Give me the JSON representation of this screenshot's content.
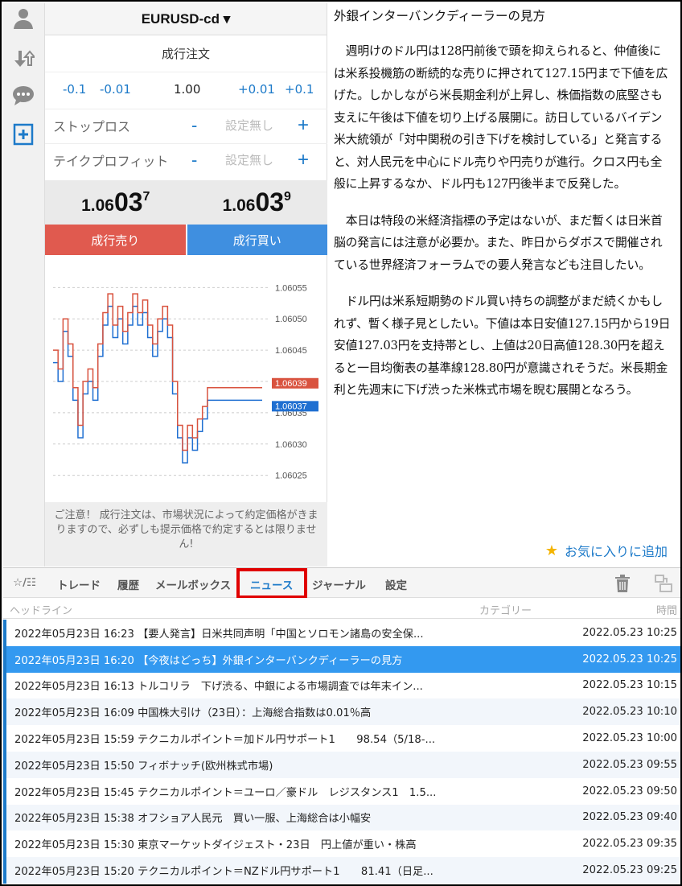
{
  "sidebar": {
    "icons": [
      "account-icon",
      "trade-transfer-icon",
      "chat-icon",
      "new-order-icon"
    ]
  },
  "order_panel": {
    "symbol": "EURUSD-cd ▾",
    "order_type": "成行注文",
    "volume_steps": {
      "m01": "-0.1",
      "m001": "-0.01",
      "p001": "+0.01",
      "p01": "+0.1"
    },
    "volume": "1.00",
    "stop_loss": {
      "label": "ストップロス",
      "minus": "-",
      "placeholder": "設定無し",
      "plus": "+"
    },
    "take_profit": {
      "label": "テイクプロフィット",
      "minus": "-",
      "placeholder": "設定無し",
      "plus": "+"
    },
    "bid": {
      "a": "1.06",
      "b": "03",
      "c": "7"
    },
    "ask": {
      "a": "1.06",
      "b": "03",
      "c": "9"
    },
    "sell_label": "成行売り",
    "buy_label": "成行買い",
    "notice": "ご注意！ 成行注文は、市場状況によって約定価格がきまりますので、必ずしも提示価格で約定するとは限りません!"
  },
  "chart_data": {
    "type": "line",
    "y_ticks": [
      "1.06055",
      "1.06050",
      "1.06045",
      "1.06040",
      "1.06035",
      "1.06030",
      "1.06025"
    ],
    "ylim": [
      1.06022,
      1.06058
    ],
    "bid_label": "1.06037",
    "ask_label": "1.06039",
    "series": [
      {
        "color": "#1f6fd1",
        "values": [
          1.06043,
          1.0604,
          1.06048,
          1.06044,
          1.06037,
          1.06031,
          1.06038,
          1.0604,
          1.06037,
          1.06044,
          1.06049,
          1.06052,
          1.06047,
          1.0605,
          1.06046,
          1.06049,
          1.06052,
          1.06049,
          1.06051,
          1.06047,
          1.06044,
          1.06048,
          1.0605,
          1.06047,
          1.06038,
          1.06031,
          1.06027,
          1.06031,
          1.06029,
          1.06032,
          1.06034,
          1.06037,
          1.06037,
          1.06037,
          1.06037,
          1.06037,
          1.06037,
          1.06037,
          1.06037,
          1.06037,
          1.06037,
          1.06037,
          1.06037
        ]
      },
      {
        "color": "#d9533f",
        "values": [
          1.06045,
          1.06042,
          1.0605,
          1.06046,
          1.06039,
          1.06033,
          1.0604,
          1.06042,
          1.06039,
          1.06046,
          1.06051,
          1.06054,
          1.06049,
          1.06052,
          1.06048,
          1.06051,
          1.06054,
          1.06051,
          1.06053,
          1.06049,
          1.06046,
          1.0605,
          1.06052,
          1.06049,
          1.0604,
          1.06033,
          1.06029,
          1.06033,
          1.06031,
          1.06034,
          1.06036,
          1.06039,
          1.06039,
          1.06039,
          1.06039,
          1.06039,
          1.06039,
          1.06039,
          1.06039,
          1.06039,
          1.06039,
          1.06039,
          1.06039
        ]
      }
    ]
  },
  "article": {
    "title": "外銀インターバンクディーラーの見方",
    "paragraphs": [
      "週明けのドル円は128円前後で頭を抑えられると、仲値後には米系投機筋の断続的な売りに押されて127.15円まで下値を広げた。しかしながら米長期金利が上昇し、株価指数の底堅さも支えに午後は下値を切り上げる展開に。訪日しているバイデン米大統領が「対中関税の引き下げを検討している」と発言すると、対人民元を中心にドル売りや円売りが進行。クロス円も全般に上昇するなか、ドル円も127円後半まで反発した。",
      "本日は特段の米経済指標の予定はないが、まだ暫くは日米首脳の発言には注意が必要か。また、昨日からダボスで開催されている世界経済フォーラムでの要人発言なども注目したい。",
      "ドル円は米系短期勢のドル買い持ちの調整がまだ続くかもしれず、暫く様子見としたい。下値は本日安値127.15円から19日安値127.03円を支持帯とし、上値は20日高値128.30円を超えると一目均衡表の基準線128.80円が意識されそうだ。米長期金利と先週末に下げ渋った米株式市場を睨む展開となろう。"
    ],
    "favorite_label": "お気に入りに追加"
  },
  "tabs": {
    "toggle": "☆/☷",
    "trade": "トレード",
    "history": "履歴",
    "mailbox": "メールボックス",
    "news": "ニュース",
    "journal": "ジャーナル",
    "settings": "設定"
  },
  "columns": {
    "headline": "ヘッドライン",
    "category": "カテゴリー",
    "time": "時間"
  },
  "news": [
    {
      "headline": "2022年05月23日 16:23 【要人発言】日米共同声明「中国とソロモン諸島の安全保...",
      "time": "2022.05.23 10:25"
    },
    {
      "headline": "2022年05月23日 16:20 【今夜はどっち】外銀インターバンクディーラーの見方",
      "time": "2022.05.23 10:25"
    },
    {
      "headline": "2022年05月23日 16:13 トルコリラ　下げ渋る、中銀による市場調査では年末イン...",
      "time": "2022.05.23 10:15"
    },
    {
      "headline": "2022年05月23日 16:09 中国株大引け（23日）：上海総合指数は0.01％高",
      "time": "2022.05.23 10:10"
    },
    {
      "headline": "2022年05月23日 15:59 テクニカルポイント＝加ドル円サポート1　　98.54（5/18-...",
      "time": "2022.05.23 10:00"
    },
    {
      "headline": "2022年05月23日 15:50 フィボナッチ(欧州株式市場)",
      "time": "2022.05.23 09:55"
    },
    {
      "headline": "2022年05月23日 15:45 テクニカルポイント＝ユーロ／豪ドル　レジスタンス1　1.5...",
      "time": "2022.05.23 09:50"
    },
    {
      "headline": "2022年05月23日 15:38 オフショア人民元　買い一服、上海総合は小幅安",
      "time": "2022.05.23 09:40"
    },
    {
      "headline": "2022年05月23日 15:30 東京マーケットダイジェスト・23日　円上値が重い・株高",
      "time": "2022.05.23 09:35"
    },
    {
      "headline": "2022年05月23日 15:20 テクニカルポイント＝NZドル円サポート1　　81.41（日足...",
      "time": "2022.05.23 09:25"
    }
  ],
  "selected_news_index": 1
}
